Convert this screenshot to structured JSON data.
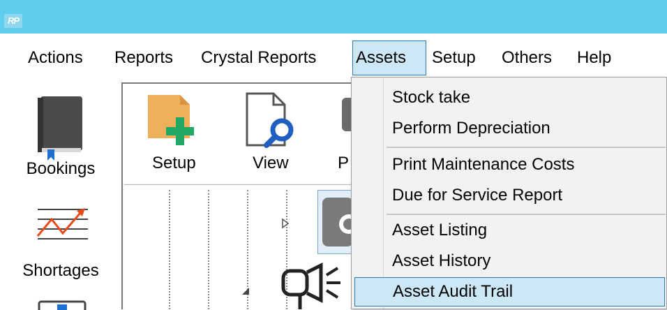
{
  "app": {
    "logo_text": "RP",
    "titlebar_color": "#5ecdee"
  },
  "menubar": {
    "items": [
      "Actions",
      "Reports",
      "Crystal Reports",
      "Assets",
      "Setup",
      "Others",
      "Help"
    ],
    "open_item": "Assets"
  },
  "sidebar": {
    "items": [
      {
        "label": "Bookings",
        "icon": "book-icon"
      },
      {
        "label": "Shortages",
        "icon": "trend-chart-icon"
      },
      {
        "label": "",
        "icon": "monitor-icon"
      }
    ]
  },
  "toolbar": {
    "buttons": [
      {
        "label": "Setup",
        "icon": "folder-add-icon"
      },
      {
        "label": "View",
        "icon": "document-search-icon"
      },
      {
        "label": "P",
        "icon": "printer-icon"
      }
    ]
  },
  "assets_menu": {
    "groups": [
      [
        "Stock take",
        "Perform Depreciation"
      ],
      [
        "Print Maintenance Costs",
        "Due for Service Report"
      ],
      [
        "Asset Listing",
        "Asset History",
        "Asset Audit Trail"
      ]
    ],
    "highlighted": "Asset Audit Trail",
    "highlight_color": "#cce8f7",
    "highlight_border": "#2a7ab8"
  }
}
